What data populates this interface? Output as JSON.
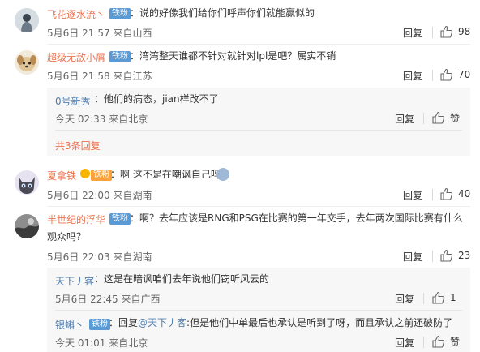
{
  "comments": [
    {
      "name": "飞花逐水流丶",
      "badge": "铁粉",
      "text": "：说的好像我们给你们呼声你们就能赢似的",
      "meta": "5月6日 21:57 来自山西",
      "reply_label": "回复",
      "likes": "98"
    },
    {
      "name": "超级无敌小屑",
      "badge": "铁粉",
      "text": "：湾湾整天谁都不针对就针对lpl是吧？属实不销",
      "meta": "5月6日 21:58 来自江苏",
      "reply_label": "回复",
      "likes": "70",
      "replies": [
        {
          "name": "0号新秀",
          "text": "：他们的病态，jian样改不了",
          "meta": "今天 02:33 来自北京",
          "reply_label": "回复",
          "likes": "赞"
        }
      ],
      "more": "共3条回复"
    },
    {
      "name": "夏拿铁",
      "badge": "铁粉",
      "text": "：啊 这不是在嘲讽自己吗",
      "meta": "5月6日 22:00 来自湖南",
      "reply_label": "回复",
      "likes": "40"
    },
    {
      "name": "半世纪的浮华",
      "badge": "铁粉",
      "text_line1": "：啊？去年应该是RNG和PSG在比赛的第一年交手，去年两次国际比赛有什么",
      "text_line2": "观众吗？",
      "meta": "5月6日 22:03 来自湖南",
      "reply_label": "回复",
      "likes": "23",
      "replies": [
        {
          "name": "天下丿客",
          "text": "：这是在暗讽咱们去年说他们窃听风云的",
          "meta": "5月6日 22:45 来自广西",
          "reply_label": "回复",
          "likes": "1"
        },
        {
          "name": "银蝌丶",
          "badge": "铁粉",
          "text_prefix": "：回复",
          "mention": "@天下丿客",
          "text_rest": ":但是他们中单最后也承认是听到了呀，而且承认之前还破防了",
          "meta": "今天 01:01 来自北京",
          "reply_label": "回复",
          "likes": "赞"
        }
      ]
    }
  ],
  "colors": {
    "name": "#eb7350",
    "link": "#507daf",
    "badge": "#5a9bd5",
    "badge_orange": "#f9a23b"
  }
}
